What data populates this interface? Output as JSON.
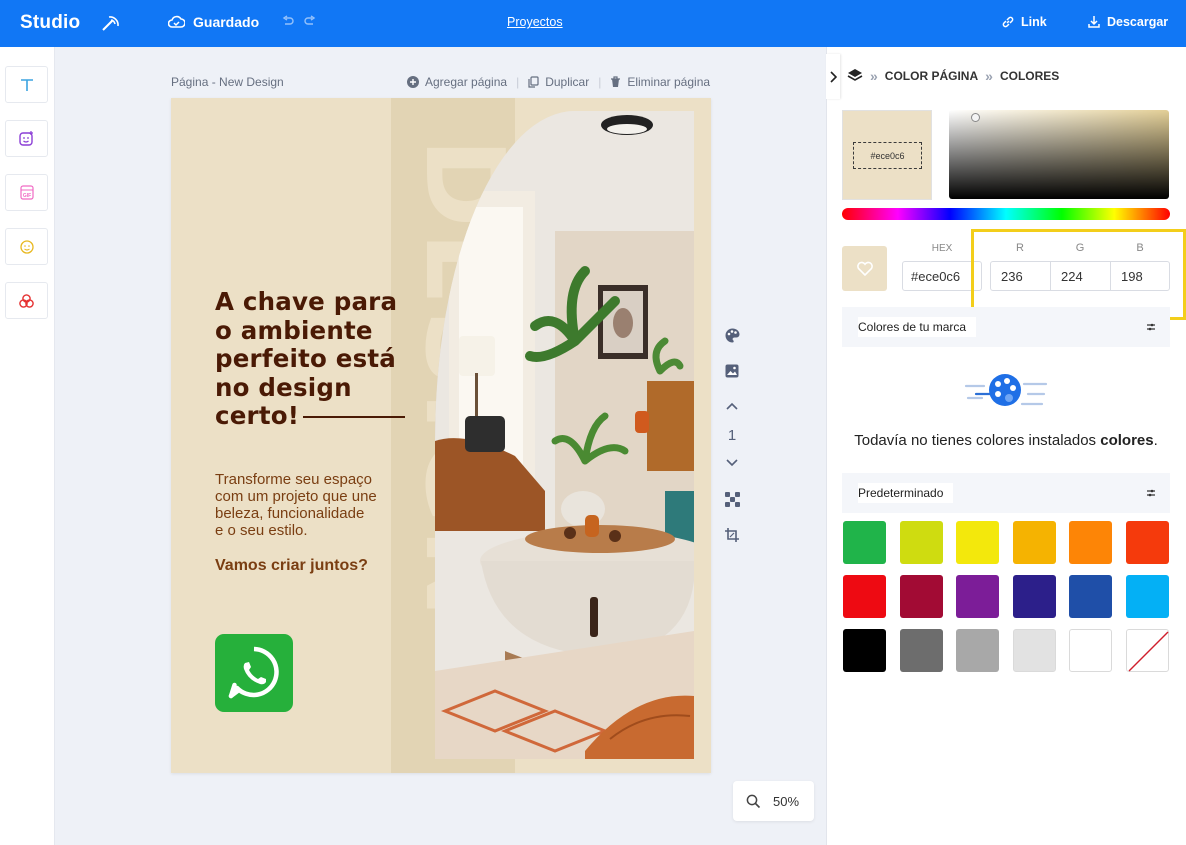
{
  "header": {
    "brand": "Studio",
    "save_status": "Guardado",
    "projects_link": "Proyectos",
    "link_label": "Link",
    "download_label": "Descargar"
  },
  "left_toolbar": {
    "tools": [
      "text-tool-icon",
      "sticker-tool-icon",
      "gif-tool-icon",
      "emoji-tool-icon",
      "shapes-tool-icon"
    ]
  },
  "canvas": {
    "page_title": "Página - New Design",
    "add_page": "Agregar página",
    "duplicate": "Duplicar",
    "delete_page": "Eliminar página",
    "page_number": "1",
    "zoom": "50%"
  },
  "design": {
    "background_word": "DESIGN",
    "headline": [
      "A chave para",
      "o ambiente",
      "perfeito está",
      "no design",
      "certo!"
    ],
    "subtext": [
      "Transforme seu espaço",
      "com um projeto que une",
      "beleza, funcionalidade",
      "e o seu estilo."
    ],
    "cta": "Vamos criar juntos?",
    "background_color": "#ece0c6"
  },
  "color_panel": {
    "breadcrumb": [
      "COLOR PÁGINA",
      "COLORES"
    ],
    "current_hex_label": "#ece0c6",
    "hex_label": "HEX",
    "hex_value": "#ece0c6",
    "r_label": "R",
    "g_label": "G",
    "b_label": "B",
    "r": "236",
    "g": "224",
    "b": "198",
    "brand_colors_title": "Colores de tu marca",
    "empty_text": "Todavía no tienes colores instalados",
    "empty_bold": "colores",
    "empty_end": ".",
    "default_title": "Predeterminado",
    "default_colors": [
      "#20b44a",
      "#cfdc10",
      "#f3e80c",
      "#f5b301",
      "#fd8506",
      "#f53a0c",
      "#ee0a12",
      "#a20b34",
      "#7c1d98",
      "#2c1f8a",
      "#1f4fa8",
      "#04b0f5",
      "#000000",
      "#6d6d6d",
      "#a8a8a8",
      "#e2e2e2",
      "#ffffff",
      "none"
    ]
  }
}
